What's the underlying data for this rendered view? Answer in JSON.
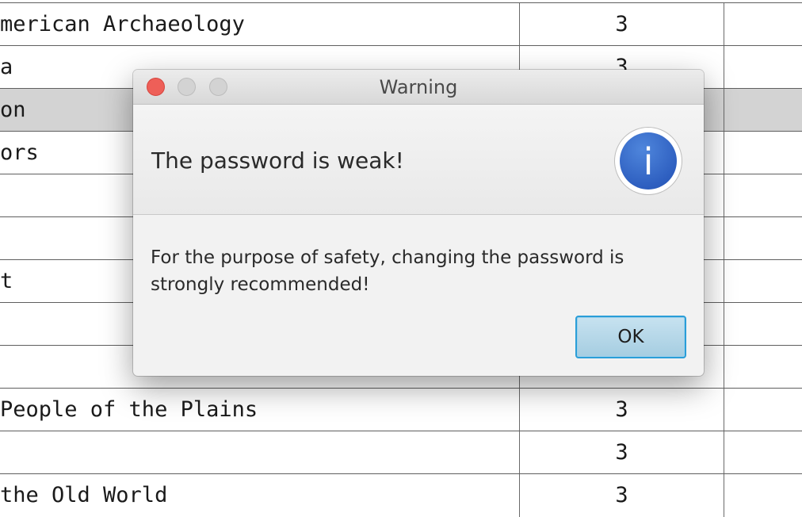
{
  "table": {
    "rows": [
      {
        "title": "merican Archaeology",
        "credits": "3",
        "selected": false
      },
      {
        "title": "a",
        "credits": "3",
        "selected": false
      },
      {
        "title": "on",
        "credits": "",
        "selected": true
      },
      {
        "title": "ors",
        "credits": "",
        "selected": false
      },
      {
        "title": "",
        "credits": "",
        "selected": false
      },
      {
        "title": "",
        "credits": "",
        "selected": false
      },
      {
        "title": "t",
        "credits": "",
        "selected": false
      },
      {
        "title": "",
        "credits": "",
        "selected": false
      },
      {
        "title": "",
        "credits": "",
        "selected": false
      },
      {
        "title": "People of the Plains",
        "credits": "3",
        "selected": false
      },
      {
        "title": "",
        "credits": "3",
        "selected": false
      },
      {
        "title": "the Old World",
        "credits": "3",
        "selected": false
      }
    ]
  },
  "dialog": {
    "title": "Warning",
    "header": "The password is weak!",
    "content": "For the purpose of safety, changing the password is strongly recommended!",
    "ok_label": "OK",
    "icon": "info-icon",
    "icon_glyph": "i",
    "colors": {
      "close": "#ee5f58",
      "icon_blue": "#2e5fc0",
      "button_border": "#2a9ed8"
    }
  }
}
